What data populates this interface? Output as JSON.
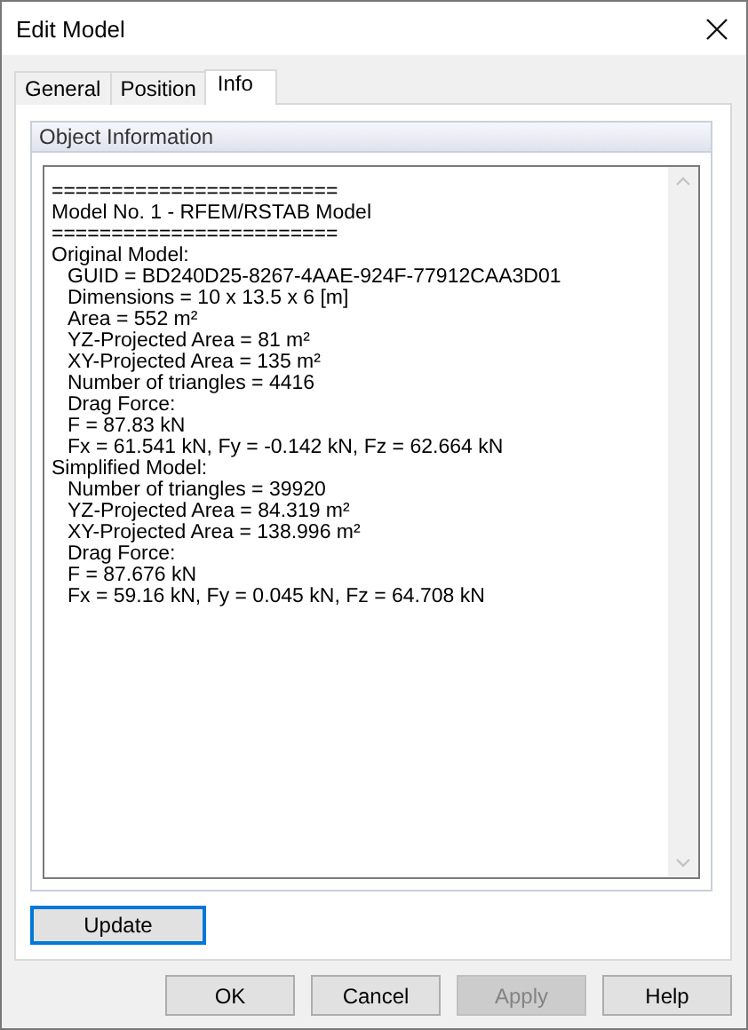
{
  "window": {
    "title": "Edit Model"
  },
  "tabs": [
    {
      "label": "General",
      "selected": false
    },
    {
      "label": "Position",
      "selected": false
    },
    {
      "label": "Info",
      "selected": true
    }
  ],
  "group": {
    "title": "Object Information"
  },
  "info_lines": [
    {
      "text": "========================"
    },
    {
      "text": "Model No. 1 - RFEM/RSTAB Model"
    },
    {
      "text": "========================"
    },
    {
      "text": "Original Model:",
      "children": [
        {
          "text": "GUID = BD240D25-8267-4AAE-924F-77912CAA3D01"
        },
        {
          "text": "Dimensions = 10 x 13.5 x 6 [m]"
        },
        {
          "text": "Area = 552 m²"
        },
        {
          "text": "YZ-Projected Area = 81 m²"
        },
        {
          "text": "XY-Projected Area = 135 m²"
        },
        {
          "text": "Number of triangles = 4416"
        },
        {
          "text": "Drag Force:"
        },
        {
          "text": "F = 87.83 kN"
        },
        {
          "text": "Fx = 61.541 kN, Fy = -0.142 kN, Fz = 62.664 kN"
        }
      ]
    },
    {
      "text": "Simplified Model:",
      "children": [
        {
          "text": "Number of triangles = 39920"
        },
        {
          "text": "YZ-Projected Area = 84.319 m²"
        },
        {
          "text": "XY-Projected Area = 138.996 m²"
        },
        {
          "text": "Drag Force:"
        },
        {
          "text": "F = 87.676 kN"
        },
        {
          "text": "Fx = 59.16 kN, Fy = 0.045 kN, Fz = 64.708 kN"
        }
      ]
    }
  ],
  "update_button": {
    "label": "Update"
  },
  "buttons": [
    {
      "label": "OK",
      "disabled": false
    },
    {
      "label": "Cancel",
      "disabled": false
    },
    {
      "label": "Apply",
      "disabled": true
    },
    {
      "label": "Help",
      "disabled": false
    }
  ]
}
